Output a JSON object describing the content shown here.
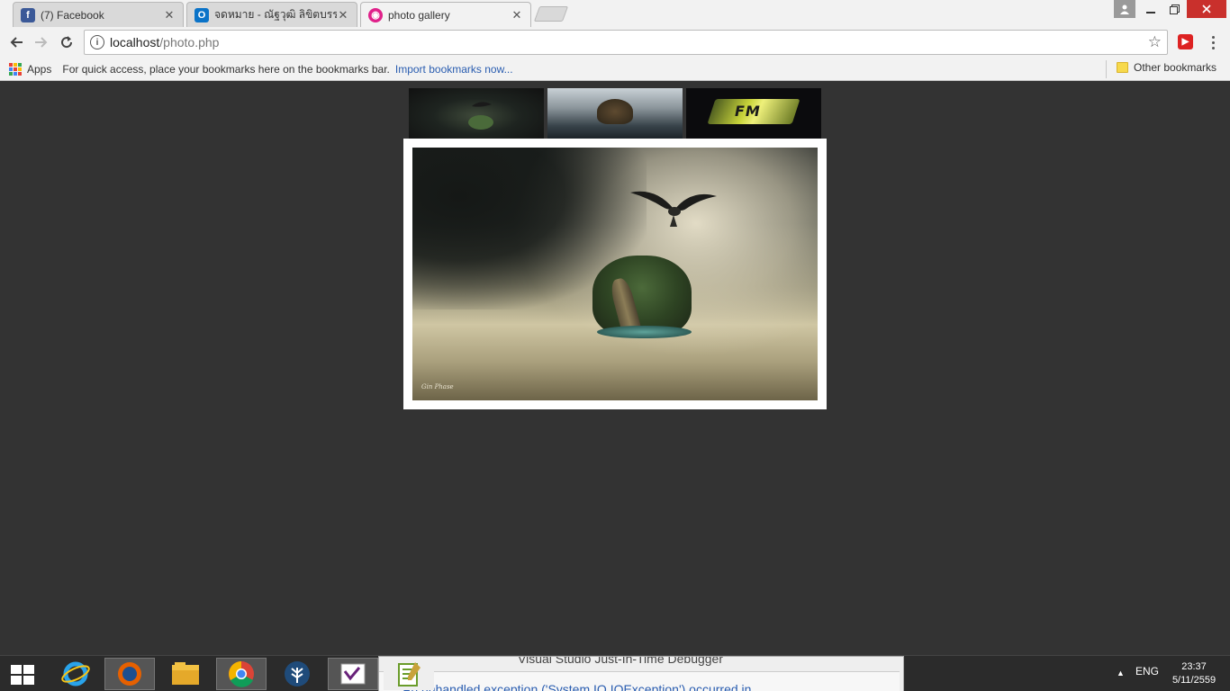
{
  "tabs": [
    {
      "title": "(7) Facebook",
      "icon": "facebook-icon",
      "color": "#3b5998",
      "glyph": "f"
    },
    {
      "title": "จดหมาย - ณัฐวุฒิ ลิขิตบรรณ",
      "icon": "outlook-icon",
      "color": "#0a73c8",
      "glyph": "O"
    },
    {
      "title": "photo gallery",
      "icon": "gallery-icon",
      "color": "#e0218a",
      "glyph": "◉"
    }
  ],
  "tab_close_glyph": "✕",
  "toolbar": {
    "url_host": "localhost",
    "url_path": "/photo.php"
  },
  "bookmarks_bar": {
    "apps_label": "Apps",
    "hint_text": "For quick access, place your bookmarks here on the bookmarks bar.",
    "import_link": "Import bookmarks now...",
    "other_bookmarks": "Other bookmarks"
  },
  "gallery": {
    "thumbnails": [
      {
        "name": "thumbnail-bird-island"
      },
      {
        "name": "thumbnail-floating-island"
      },
      {
        "name": "thumbnail-fm-logo",
        "text": "FM"
      }
    ],
    "main_photo": {
      "signature": "Gin Phase"
    }
  },
  "taskbar": {
    "popup_title": "Visual Studio Just-In-Time Debugger",
    "popup_message": "An unhandled exception ('System.IO.IOException') occurred in",
    "language": "ENG",
    "time": "23:37",
    "date": "5/11/2559"
  }
}
